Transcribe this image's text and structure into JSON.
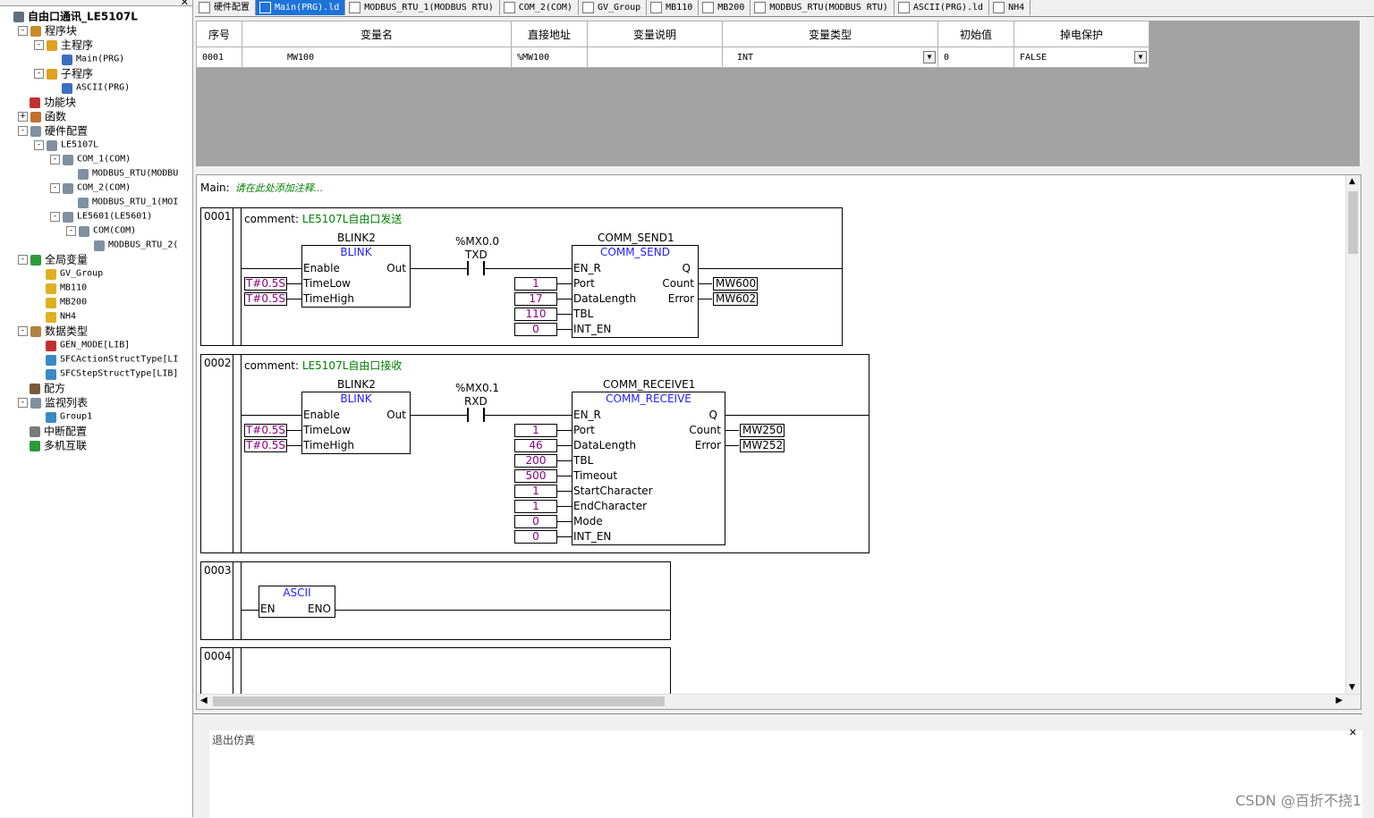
{
  "tree": {
    "items": [
      {
        "label": "自由口通讯_LE5107L",
        "level": 0,
        "expander": "",
        "bold": true,
        "icon": "gear-icon",
        "color": "#607080"
      },
      {
        "label": "程序块",
        "level": 1,
        "expander": "-",
        "icon": "folder-program-icon",
        "color": "#c98a2a"
      },
      {
        "label": "主程序",
        "level": 2,
        "expander": "-",
        "icon": "folder-icon",
        "color": "#e0a020"
      },
      {
        "label": "Main(PRG)",
        "level": 3,
        "expander": "",
        "icon": "ladder-icon",
        "color": "#3a6fc4",
        "small": true
      },
      {
        "label": "子程序",
        "level": 2,
        "expander": "-",
        "icon": "folder-icon",
        "color": "#e0a020"
      },
      {
        "label": "ASCII(PRG)",
        "level": 3,
        "expander": "",
        "icon": "ladder-icon",
        "color": "#3a6fc4",
        "small": true
      },
      {
        "label": "功能块",
        "level": 1,
        "expander": "",
        "icon": "function-block-icon",
        "color": "#c03030"
      },
      {
        "label": "函数",
        "level": 1,
        "expander": "+",
        "icon": "function-icon",
        "color": "#c07030"
      },
      {
        "label": "硬件配置",
        "level": 1,
        "expander": "-",
        "icon": "hardware-icon",
        "color": "#8090a0"
      },
      {
        "label": "LE5107L",
        "level": 2,
        "expander": "-",
        "icon": "module-icon",
        "color": "#8090a0",
        "small": true
      },
      {
        "label": "COM_1(COM)",
        "level": 3,
        "expander": "-",
        "icon": "module-icon",
        "color": "#8090a0",
        "small": true
      },
      {
        "label": "MODBUS_RTU(MODBU",
        "level": 4,
        "expander": "",
        "icon": "module-icon",
        "color": "#8090a0",
        "small": true
      },
      {
        "label": "COM_2(COM)",
        "level": 3,
        "expander": "-",
        "icon": "module-icon",
        "color": "#8090a0",
        "small": true
      },
      {
        "label": "MODBUS_RTU_1(MOI",
        "level": 4,
        "expander": "",
        "icon": "module-icon",
        "color": "#8090a0",
        "small": true
      },
      {
        "label": "LE5601(LE5601)",
        "level": 3,
        "expander": "-",
        "icon": "module-icon",
        "color": "#8090a0",
        "small": true
      },
      {
        "label": "COM(COM)",
        "level": 4,
        "expander": "-",
        "icon": "module-icon",
        "color": "#8090a0",
        "small": true
      },
      {
        "label": "MODBUS_RTU_2(",
        "level": 5,
        "expander": "",
        "icon": "module-icon",
        "color": "#8090a0",
        "small": true
      },
      {
        "label": "全局变量",
        "level": 1,
        "expander": "-",
        "icon": "global-variable-icon",
        "color": "#2a9a3a"
      },
      {
        "label": "GV_Group",
        "level": 2,
        "expander": "",
        "icon": "variable-icon",
        "color": "#e0b020",
        "small": true
      },
      {
        "label": "MB110",
        "level": 2,
        "expander": "",
        "icon": "variable-icon",
        "color": "#e0b020",
        "small": true
      },
      {
        "label": "MB200",
        "level": 2,
        "expander": "",
        "icon": "variable-icon",
        "color": "#e0b020",
        "small": true
      },
      {
        "label": "NH4",
        "level": 2,
        "expander": "",
        "icon": "variable-icon",
        "color": "#e0b020",
        "small": true
      },
      {
        "label": "数据类型",
        "level": 1,
        "expander": "-",
        "icon": "data-type-icon",
        "color": "#b08040"
      },
      {
        "label": "GEN_MODE[LIB]",
        "level": 2,
        "expander": "",
        "icon": "data-type-icon",
        "color": "#c03030",
        "small": true
      },
      {
        "label": "SFCActionStructType[LI",
        "level": 2,
        "expander": "",
        "icon": "struct-icon",
        "color": "#3a8ac4",
        "small": true
      },
      {
        "label": "SFCStepStructType[LIB]",
        "level": 2,
        "expander": "",
        "icon": "struct-icon",
        "color": "#3a8ac4",
        "small": true
      },
      {
        "label": "配方",
        "level": 1,
        "expander": "",
        "icon": "recipe-icon",
        "color": "#7a5a3a"
      },
      {
        "label": "监视列表",
        "level": 1,
        "expander": "-",
        "icon": "watch-list-icon",
        "color": "#8090a0"
      },
      {
        "label": "Group1",
        "level": 2,
        "expander": "",
        "icon": "watch-group-icon",
        "color": "#3a8ac4",
        "small": true
      },
      {
        "label": "中断配置",
        "level": 1,
        "expander": "",
        "icon": "interrupt-icon",
        "color": "#7a7a7a"
      },
      {
        "label": "多机互联",
        "level": 1,
        "expander": "",
        "icon": "network-icon",
        "color": "#2a9a3a"
      }
    ]
  },
  "tabs": [
    {
      "label": "硬件配置",
      "active": false,
      "icon": "hardware-icon"
    },
    {
      "label": "Main(PRG).ld",
      "active": true,
      "icon": "ladder-icon"
    },
    {
      "label": "MODBUS_RTU_1(MODBUS RTU)",
      "active": false,
      "icon": "module-icon"
    },
    {
      "label": "COM_2(COM)",
      "active": false,
      "icon": "module-icon"
    },
    {
      "label": "GV_Group",
      "active": false,
      "icon": "variable-icon"
    },
    {
      "label": "MB110",
      "active": false,
      "icon": "variable-icon"
    },
    {
      "label": "MB200",
      "active": false,
      "icon": "variable-icon"
    },
    {
      "label": "MODBUS_RTU(MODBUS RTU)",
      "active": false,
      "icon": "module-icon"
    },
    {
      "label": "ASCII(PRG).ld",
      "active": false,
      "icon": "ladder-icon"
    },
    {
      "label": "NH4",
      "active": false,
      "icon": "variable-icon"
    }
  ],
  "var_table": {
    "headers": [
      "序号",
      "变量名",
      "直接地址",
      "变量说明",
      "变量类型",
      "初始值",
      "掉电保护"
    ],
    "rows": [
      {
        "index": "0001",
        "name": "MW100",
        "address": "%MW100",
        "desc": "",
        "type": "INT",
        "init": "0",
        "retain": "FALSE"
      }
    ]
  },
  "editor": {
    "main_label": "Main:",
    "main_comment": "请在此处添加注释...",
    "networks": [
      {
        "number": "0001",
        "comment_prefix": "comment:",
        "comment": "LE5107L自由口发送",
        "blink_instance": "BLINK2",
        "blink_type": "BLINK",
        "blink_pins": {
          "in": [
            "Enable",
            "TimeLow",
            "TimeHigh"
          ],
          "out": "Out"
        },
        "blink_consts": [
          "T#0.5S",
          "T#0.5S"
        ],
        "contact_addr": "%MX0.0",
        "contact_name": "TXD",
        "fb_instance": "COMM_SEND1",
        "fb_type": "COMM_SEND",
        "fb_inputs": [
          "EN_R",
          "Port",
          "DataLength",
          "TBL",
          "INT_EN"
        ],
        "fb_outputs": [
          "Q",
          "Count",
          "Error"
        ],
        "in_consts": [
          "1",
          "17",
          "110",
          "0"
        ],
        "out_vars": [
          "MW600",
          "MW602"
        ]
      },
      {
        "number": "0002",
        "comment_prefix": "comment:",
        "comment": "LE5107L自由口接收",
        "blink_instance": "BLINK2",
        "blink_type": "BLINK",
        "blink_pins": {
          "in": [
            "Enable",
            "TimeLow",
            "TimeHigh"
          ],
          "out": "Out"
        },
        "blink_consts": [
          "T#0.5S",
          "T#0.5S"
        ],
        "contact_addr": "%MX0.1",
        "contact_name": "RXD",
        "fb_instance": "COMM_RECEIVE1",
        "fb_type": "COMM_RECEIVE",
        "fb_inputs": [
          "EN_R",
          "Port",
          "DataLength",
          "TBL",
          "Timeout",
          "StartCharacter",
          "EndCharacter",
          "Mode",
          "INT_EN"
        ],
        "fb_outputs": [
          "Q",
          "Count",
          "Error"
        ],
        "in_consts": [
          "1",
          "46",
          "200",
          "500",
          "1",
          "1",
          "0",
          "0"
        ],
        "out_vars": [
          "MW250",
          "MW252"
        ]
      },
      {
        "number": "0003",
        "block_type": "ASCII",
        "block_in": "EN",
        "block_out": "ENO"
      },
      {
        "number": "0004"
      }
    ]
  },
  "output": {
    "message": "退出仿真"
  },
  "watermark": "CSDN @百折不挠1"
}
